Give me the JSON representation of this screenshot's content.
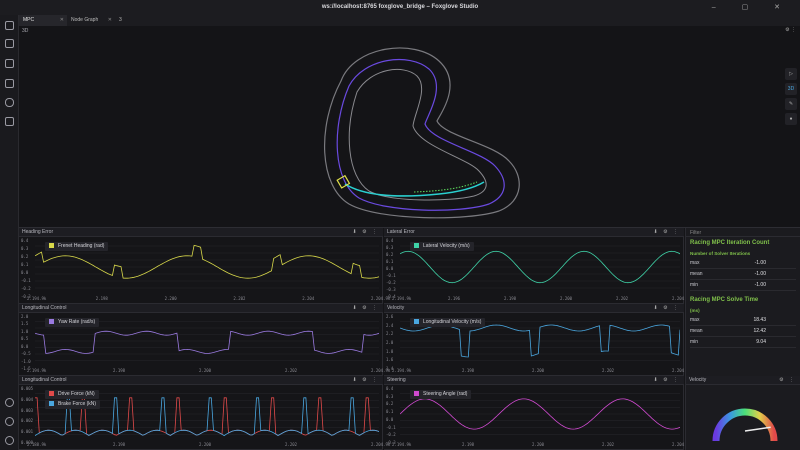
{
  "window": {
    "title": "ws://localhost:8765 foxglove_bridge – Foxglove Studio"
  },
  "tabs": [
    {
      "label": "MPC"
    },
    {
      "label": "Node Graph"
    },
    {
      "label": "3"
    }
  ],
  "scene": {
    "label": "3D",
    "mode": "3D"
  },
  "panels": {
    "heading": {
      "title": "Heading Error",
      "legend": "Frenet Heading (rad)",
      "color": "#d8d84a",
      "yticks": [
        "0.4",
        "0.3",
        "0.2",
        "0.1",
        "0.0",
        "-0.1",
        "-0.2",
        "-0.3"
      ],
      "xticks": [
        "2.194.9k",
        "2.198",
        "2.200",
        "2.202",
        "2.204",
        "2.204.9k"
      ]
    },
    "lateral": {
      "title": "Lateral Error",
      "legend": "Lateral Velocity (m/s)",
      "color": "#3fd3a8",
      "yticks": [
        "0.4",
        "0.3",
        "0.2",
        "0.1",
        "0.0",
        "-0.1",
        "-0.2",
        "-0.3",
        "-0.4"
      ],
      "xticks": [
        "2.194.9k",
        "2.196",
        "2.198",
        "2.200",
        "2.202",
        "2.204.9k"
      ]
    },
    "long1": {
      "title": "Longitudinal Control",
      "legend": "Yaw Rate (rad/s)",
      "color": "#9a7ae0",
      "yticks": [
        "2.0",
        "1.5",
        "1.0",
        "0.5",
        "0.0",
        "-0.5",
        "-1.0",
        "-1.5"
      ],
      "xticks": [
        "2.194.9k",
        "2.198",
        "2.200",
        "2.202",
        "2.204.9k"
      ]
    },
    "velocity": {
      "title": "Velocity",
      "legend": "Longitudinal Velocity (m/s)",
      "color": "#4aa7e0",
      "yticks": [
        "2.6",
        "2.4",
        "2.2",
        "2.0",
        "1.8",
        "1.6",
        "1.4"
      ],
      "xticks": [
        "2.194.9k",
        "2.198",
        "2.200",
        "2.202",
        "2.204.9k"
      ]
    },
    "long2": {
      "title": "Longitudinal Control",
      "legends": [
        "Drive Force (kN)",
        "Brake Force (kN)"
      ],
      "colors": [
        "#e04a4a",
        "#4aa7e0"
      ],
      "yticks": [
        "0.005",
        "0.004",
        "0.003",
        "0.002",
        "0.001",
        "0.000"
      ],
      "xticks": [
        "2.188.9k",
        "2.198",
        "2.200",
        "2.202",
        "2.204.9k"
      ]
    },
    "steering": {
      "title": "Steering",
      "legend": "Steering Angle (rad)",
      "color": "#d04ad0",
      "yticks": [
        "0.4",
        "0.3",
        "0.2",
        "0.1",
        "0.0",
        "-0.1",
        "-0.2",
        "-0.3"
      ],
      "xticks": [
        "2.194.9k",
        "2.198",
        "2.200",
        "2.202",
        "2.204.9k"
      ]
    }
  },
  "stats": {
    "filter": "Filter",
    "iter": {
      "title": "Racing MPC Iteration Count",
      "sub": "Number of Solver Iterations",
      "rows": [
        {
          "k": "max",
          "v": "-1.00"
        },
        {
          "k": "mean",
          "v": "-1.00"
        },
        {
          "k": "min",
          "v": "-1.00"
        }
      ]
    },
    "solve": {
      "title": "Racing MPC Solve Time",
      "sub": "(ms)",
      "rows": [
        {
          "k": "max",
          "v": "18.43"
        },
        {
          "k": "mean",
          "v": "12.42"
        },
        {
          "k": "min",
          "v": "9.04"
        }
      ]
    }
  },
  "gauge": {
    "title": "Velocity",
    "value_fraction": 0.85
  }
}
